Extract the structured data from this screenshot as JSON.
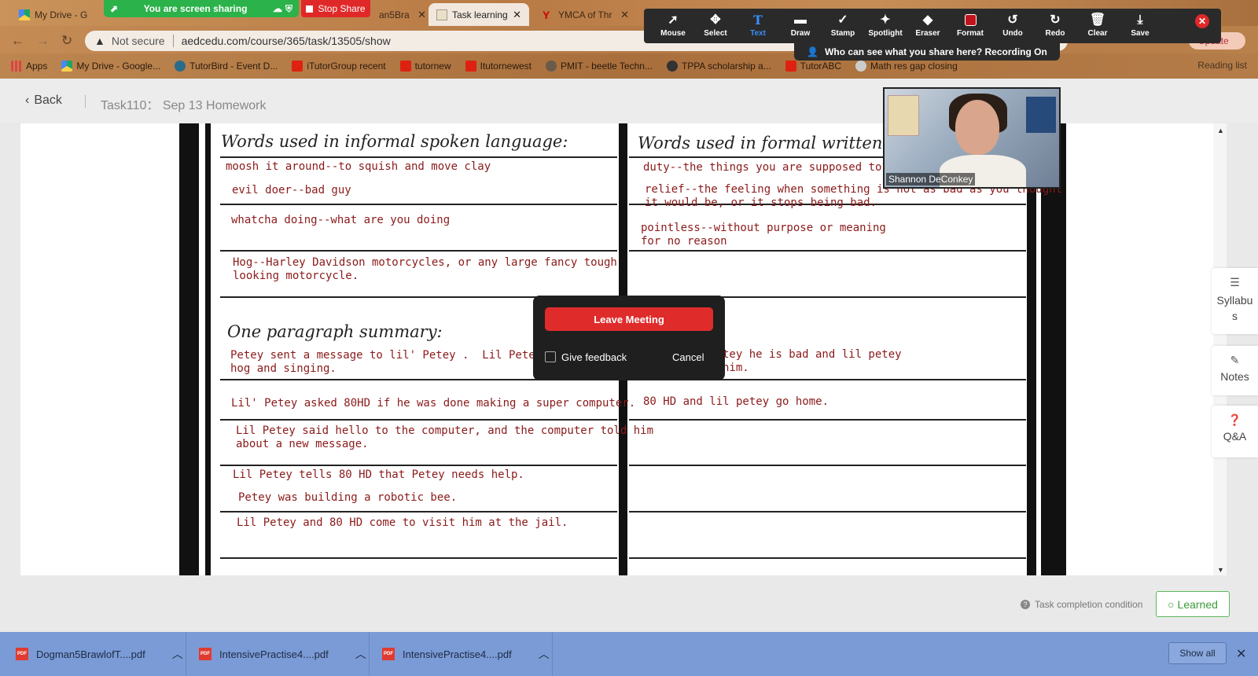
{
  "browser": {
    "tabs": [
      {
        "label": "My Drive - G"
      },
      {
        "label": "an5Bra"
      },
      {
        "label": "Task learning"
      },
      {
        "label": "YMCA of Thr"
      }
    ],
    "share_status": "You are screen sharing",
    "stop_share": "Stop Share",
    "not_secure": "Not secure",
    "url": "aedcedu.com/course/365/task/13505/show",
    "update": "Update",
    "bookmarks": [
      "Apps",
      "My Drive - Google...",
      "TutorBird - Event D...",
      "iTutorGroup recent",
      "tutornew",
      "Itutornewest",
      "PMIT - beetle Techn...",
      "TPPA scholarship a...",
      "TutorABC",
      "Math res gap closing"
    ],
    "reading_list": "Reading list"
  },
  "zoom_toolbar": {
    "tools": [
      {
        "label": "Mouse",
        "icon": "cursor-icon"
      },
      {
        "label": "Select",
        "icon": "move-icon"
      },
      {
        "label": "Text",
        "icon": "text-icon"
      },
      {
        "label": "Draw",
        "icon": "draw-icon"
      },
      {
        "label": "Stamp",
        "icon": "check-icon"
      },
      {
        "label": "Spotlight",
        "icon": "spotlight-icon"
      },
      {
        "label": "Eraser",
        "icon": "eraser-icon"
      },
      {
        "label": "Format",
        "icon": "format-icon"
      },
      {
        "label": "Undo",
        "icon": "undo-icon"
      },
      {
        "label": "Redo",
        "icon": "redo-icon"
      },
      {
        "label": "Clear",
        "icon": "trash-icon"
      },
      {
        "label": "Save",
        "icon": "save-icon"
      }
    ],
    "selected_tool": "Text",
    "format_color": "#c0141c",
    "who_can_see": "Who can see what you share here? Recording On"
  },
  "header": {
    "back": "Back",
    "task_title": "Task110： Sep 13 Homework"
  },
  "worksheet": {
    "left_title": "Words used in informal spoken language:",
    "right_title": "Words used in formal written la",
    "left_entries": [
      "moosh it around--to squish and move clay",
      "evil doer--bad guy",
      "whatcha doing--what are you doing",
      "Hog--Harley Davidson motorcycles, or any large fancy tough\nlooking motorcycle."
    ],
    "right_entries": [
      "duty--the things you are supposed to do--",
      "relief--the feeling when something is not as bad as you thought\nit would be, or it stops being bad.",
      "pointless--without purpose or meaning\nfor no reason"
    ],
    "summary_title": "One paragraph summary:",
    "summary_left": [
      "Petey sent a message to lil' Petey .  Lil Petey was makin\nhog and singing.",
      "Lil' Petey asked 80HD if he was done making a super computer.",
      "Lil Petey said hello to the computer, and the computer told him\nabout a new message.",
      "Lil Petey tells 80 HD that Petey needs help.",
      "Petey was building a robotic bee.",
      "Lil Petey and 80 HD come to visit him at the jail."
    ],
    "summary_right": [
      "tey he is bad and lil petey\nhim.",
      "80 HD and lil petey go home."
    ]
  },
  "webcam": {
    "name": "Shannon DeConkey"
  },
  "dialog": {
    "leave": "Leave Meeting",
    "feedback": "Give feedback",
    "cancel": "Cancel"
  },
  "side_panel": [
    {
      "label": "Syllabu\ns",
      "icon": "menu-icon"
    },
    {
      "label": "Notes",
      "icon": "pencil-icon"
    },
    {
      "label": "Q&A",
      "icon": "question-icon"
    }
  ],
  "footer": {
    "hint": "Task completion condition",
    "learned": "Learned"
  },
  "downloads": {
    "files": [
      "Dogman5BrawlofT....pdf",
      "IntensivePractise4....pdf",
      "IntensivePractise4....pdf"
    ],
    "show_all": "Show all"
  }
}
